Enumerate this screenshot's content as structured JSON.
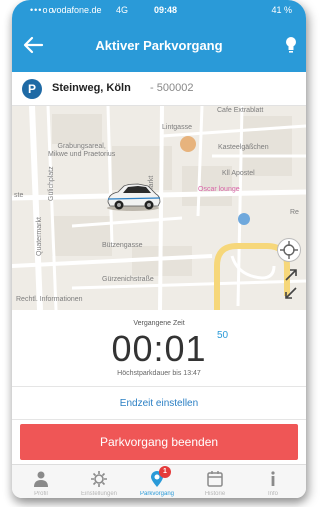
{
  "status_bar": {
    "signal": "•••oo",
    "carrier": "vodafone.de",
    "network": "4G",
    "time": "09:48",
    "battery": "41 %"
  },
  "nav": {
    "title": "Aktiver Parkvorgang",
    "back_icon": "arrow-left-icon",
    "help_icon": "lightbulb-icon"
  },
  "location": {
    "pin": "P",
    "street": "Steinweg, Köln",
    "separator": " - ",
    "zone_code": "500002"
  },
  "map": {
    "labels": {
      "cafe": "Cafe Extrablatt",
      "lintgasse": "Lintgasse",
      "grabungsareal": "Grabungsareal,\nMikwe und Praetorius",
      "kasteelgasse": "Kasteelgäßchen",
      "apostel": "Kll Apostel",
      "oscar": "Oscar lounge",
      "heumarkt": "Heumarkt",
      "quatermarkt": "Quatermarkt",
      "gurzenich": "Gülichplatz",
      "buetzengasse": "Bützengasse",
      "gurzenichstrasse": "Gürzenichstraße",
      "rechtl": "Rechtl. Informationen",
      "ste": "ste",
      "re": "Re"
    },
    "colors": {
      "road": "#ffffff",
      "highlight": "#f6d77a",
      "bg": "#efece6"
    }
  },
  "timer": {
    "label": "Vergangene Zeit",
    "elapsed": "00:01",
    "seconds": "50",
    "max_duration": "Höchstparkdauer bis 13:47"
  },
  "end_time_link": "Endzeit einstellen",
  "end_button": "Parkvorgang beenden",
  "tabs": [
    {
      "label": "Profil",
      "icon": "person-icon",
      "active": false
    },
    {
      "label": "Einstellungen",
      "icon": "gear-icon",
      "active": false
    },
    {
      "label": "Parkvorgang",
      "icon": "parking-pin-icon",
      "active": true,
      "badge": "1"
    },
    {
      "label": "Historie",
      "icon": "calendar-icon",
      "active": false
    },
    {
      "label": "Info",
      "icon": "info-icon",
      "active": false
    }
  ],
  "accent": "#2a9ad8",
  "danger": "#ef5656"
}
